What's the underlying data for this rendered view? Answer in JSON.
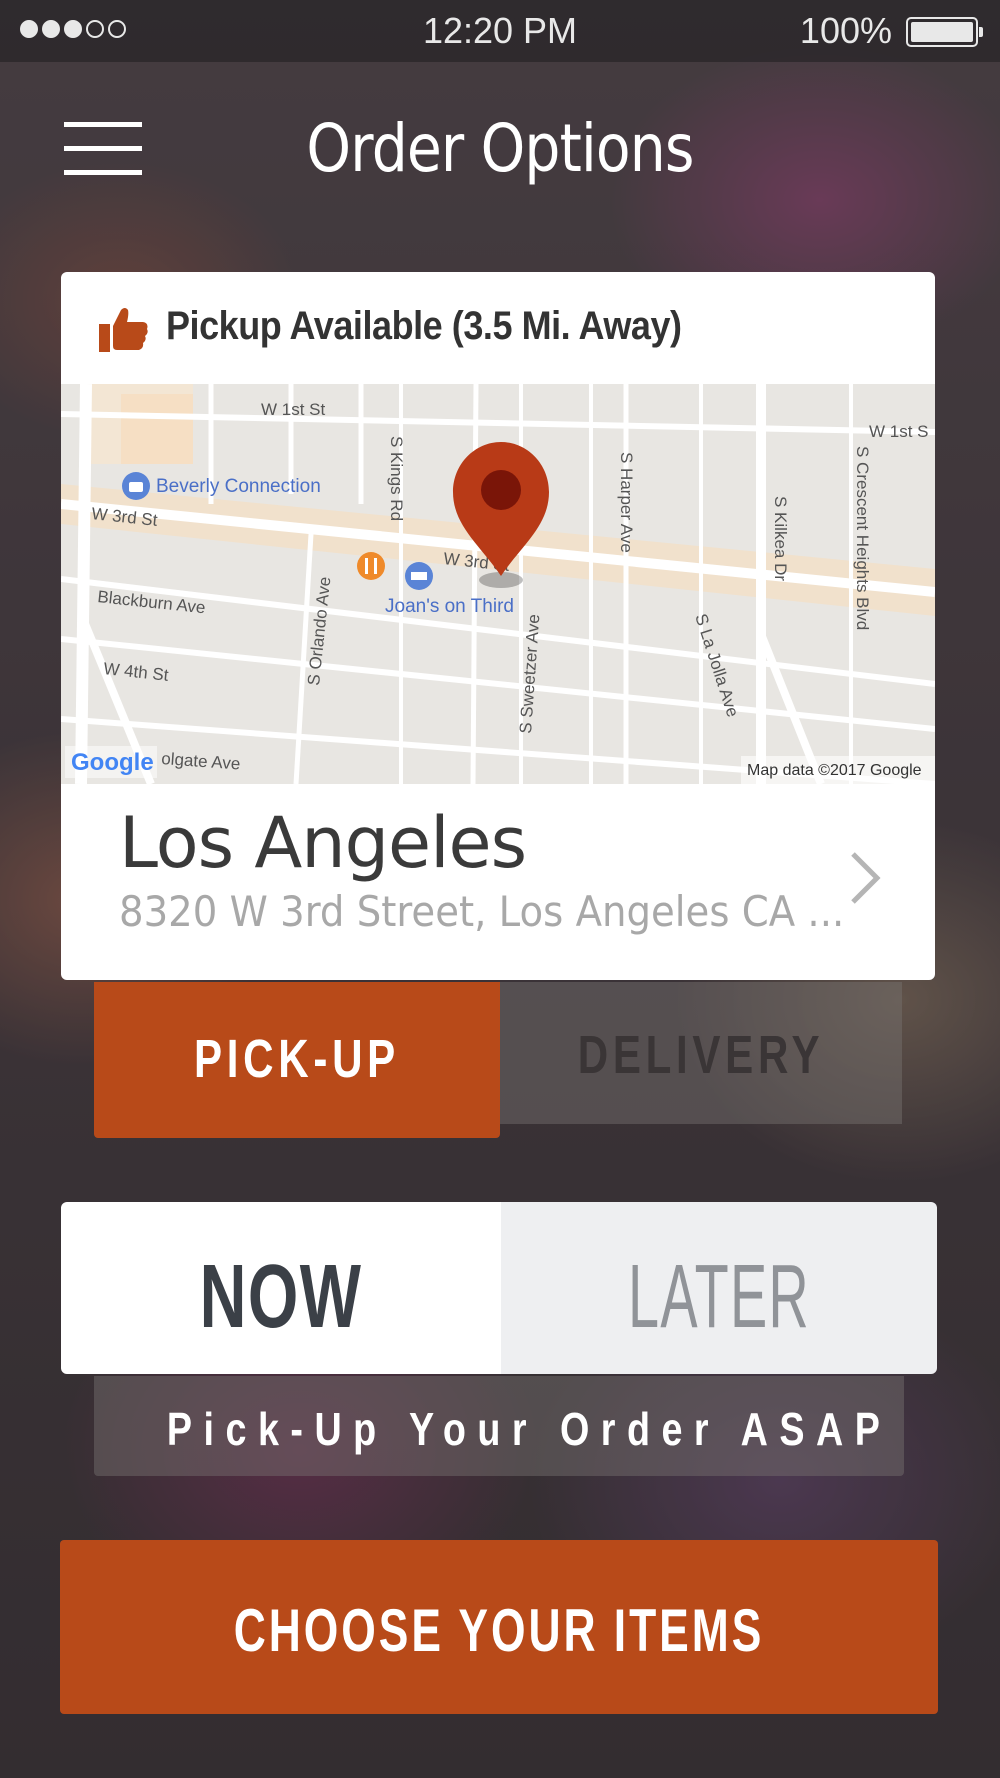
{
  "status_bar": {
    "signal_dots_filled": 3,
    "signal_dots_total": 5,
    "time": "12:20 PM",
    "battery_text": "100%",
    "battery_level": 1.0
  },
  "header": {
    "title": "Order Options",
    "menu_icon": "hamburger-menu-icon"
  },
  "location_card": {
    "availability_icon": "thumbs-up-icon",
    "availability_text": "Pickup Available (3.5 Mi. Away)",
    "map": {
      "streets": [
        "W 1st St",
        "W 1st S",
        "W 3rd St",
        "W 3rd St",
        "Blackburn Ave",
        "W 4th St",
        "olgate Ave",
        "S Kings Rd",
        "S Orlando Ave",
        "S Sweetzer Ave",
        "S Harper Ave",
        "S Kilkea Dr",
        "S La Jolla Ave",
        "S Crescent Heights Blvd"
      ],
      "places": [
        "Beverly Connection",
        "Joan's on Third"
      ],
      "logo": "Google",
      "attribution": "Map data ©2017 Google"
    },
    "name": "Los Angeles",
    "address": "8320 W 3rd Street, Los Angeles CA ...",
    "chevron_icon": "chevron-right-icon"
  },
  "order_type": {
    "pickup_label": "PICK-UP",
    "delivery_label": "DELIVERY",
    "selected": "pickup"
  },
  "timing": {
    "now_label": "NOW",
    "later_label": "LATER",
    "selected": "now",
    "note": "Pick-Up Your Order ASAP"
  },
  "cta": {
    "label": "CHOOSE YOUR ITEMS"
  },
  "colors": {
    "accent": "#b84a19",
    "pin": "#b83a17",
    "pin_center": "#7a1508"
  }
}
